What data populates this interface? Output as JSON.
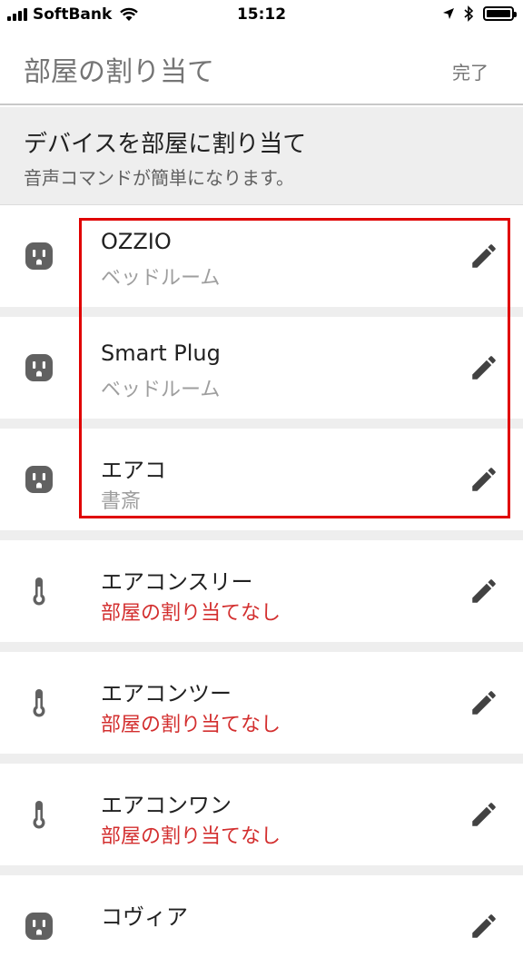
{
  "status_bar": {
    "carrier": "SoftBank",
    "time": "15:12",
    "icons": [
      "signal-icon",
      "wifi-icon",
      "location-arrow-icon",
      "bluetooth-icon",
      "battery-icon"
    ]
  },
  "app_bar": {
    "title": "部屋の割り当て",
    "done_label": "完了"
  },
  "section": {
    "title": "デバイスを部屋に割り当て",
    "subtitle": "音声コマンドが簡単になります。"
  },
  "devices": [
    {
      "name": "OZZIO",
      "room": "ベッドルーム",
      "icon": "outlet-icon",
      "assigned": true
    },
    {
      "name": "Smart Plug",
      "room": "ベッドルーム",
      "icon": "outlet-icon",
      "assigned": true
    },
    {
      "name": "エアコ",
      "room": "書斎",
      "icon": "outlet-icon",
      "assigned": true
    },
    {
      "name": "エアコンスリー",
      "room": "部屋の割り当てなし",
      "icon": "thermometer-icon",
      "assigned": false
    },
    {
      "name": "エアコンツー",
      "room": "部屋の割り当てなし",
      "icon": "thermometer-icon",
      "assigned": false
    },
    {
      "name": "エアコンワン",
      "room": "部屋の割り当てなし",
      "icon": "thermometer-icon",
      "assigned": false
    },
    {
      "name": "コヴィア",
      "room": "",
      "icon": "outlet-icon",
      "assigned": true
    }
  ],
  "colors": {
    "unassigned_text": "#d32f2f",
    "highlight_border": "#e00000",
    "icon": "#616161"
  }
}
